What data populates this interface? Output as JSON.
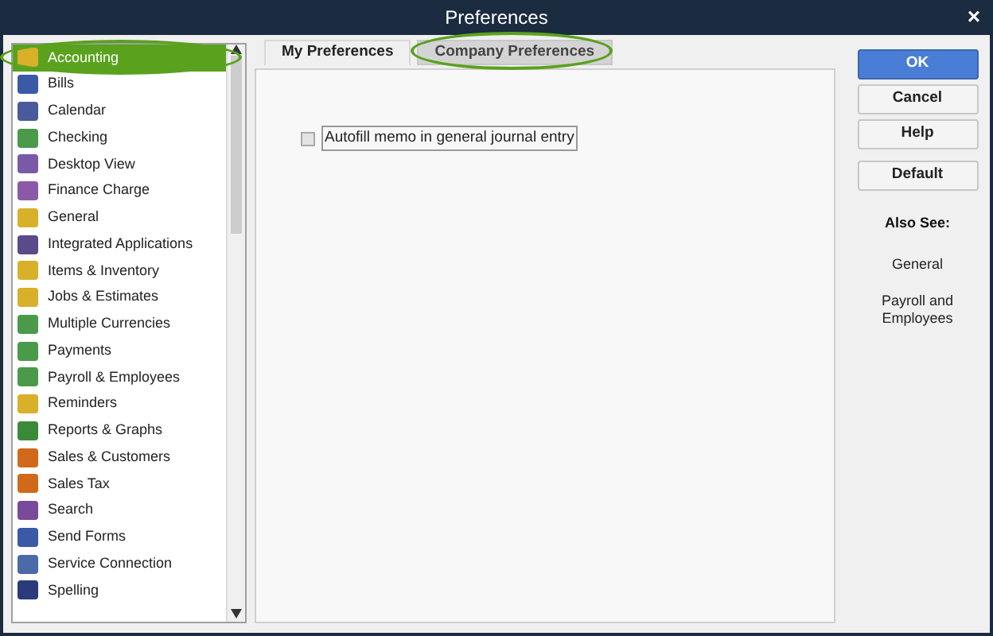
{
  "window": {
    "title": "Preferences",
    "close": "×"
  },
  "categories": [
    {
      "label": "Accounting",
      "selected": true
    },
    {
      "label": "Bills",
      "selected": false
    },
    {
      "label": "Calendar",
      "selected": false
    },
    {
      "label": "Checking",
      "selected": false
    },
    {
      "label": "Desktop View",
      "selected": false
    },
    {
      "label": "Finance Charge",
      "selected": false
    },
    {
      "label": "General",
      "selected": false
    },
    {
      "label": "Integrated Applications",
      "selected": false
    },
    {
      "label": "Items & Inventory",
      "selected": false
    },
    {
      "label": "Jobs & Estimates",
      "selected": false
    },
    {
      "label": "Multiple Currencies",
      "selected": false
    },
    {
      "label": "Payments",
      "selected": false
    },
    {
      "label": "Payroll & Employees",
      "selected": false
    },
    {
      "label": "Reminders",
      "selected": false
    },
    {
      "label": "Reports & Graphs",
      "selected": false
    },
    {
      "label": "Sales & Customers",
      "selected": false
    },
    {
      "label": "Sales Tax",
      "selected": false
    },
    {
      "label": "Search",
      "selected": false
    },
    {
      "label": "Send Forms",
      "selected": false
    },
    {
      "label": "Service Connection",
      "selected": false
    },
    {
      "label": "Spelling",
      "selected": false
    }
  ],
  "tabs": [
    {
      "label": "My Preferences",
      "selected": true
    },
    {
      "label": "Company Preferences",
      "selected": false
    }
  ],
  "options": [
    {
      "label": "Autofill memo in general journal entry",
      "checked": false
    }
  ],
  "buttons": [
    {
      "label": "OK",
      "kind": "primary"
    },
    {
      "label": "Cancel",
      "kind": "normal"
    },
    {
      "label": "Help",
      "kind": "normal"
    },
    {
      "label": "Default",
      "kind": "spaced"
    }
  ],
  "also_see": {
    "title": "Also See:",
    "links": [
      "General",
      "Payroll and Employees"
    ]
  }
}
